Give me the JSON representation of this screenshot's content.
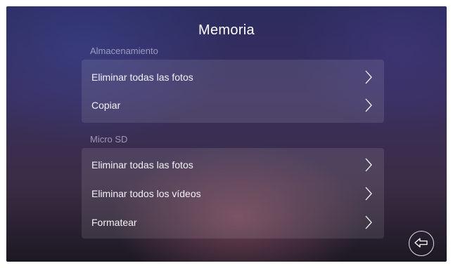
{
  "header": {
    "title": "Memoria"
  },
  "storage": {
    "label": "Almacenamiento",
    "items": [
      {
        "label": "Eliminar todas las fotos",
        "icon": "chevron-right-icon"
      },
      {
        "label": "Copiar",
        "icon": "chevron-right-icon"
      }
    ]
  },
  "microsd": {
    "label": "Micro SD",
    "items": [
      {
        "label": "Eliminar todas las fotos",
        "icon": "chevron-right-icon"
      },
      {
        "label": "Eliminar todos los vídeos",
        "icon": "chevron-right-icon"
      },
      {
        "label": "Formatear",
        "icon": "chevron-right-icon"
      }
    ]
  },
  "footer": {
    "back_icon": "back-arrow-icon"
  }
}
